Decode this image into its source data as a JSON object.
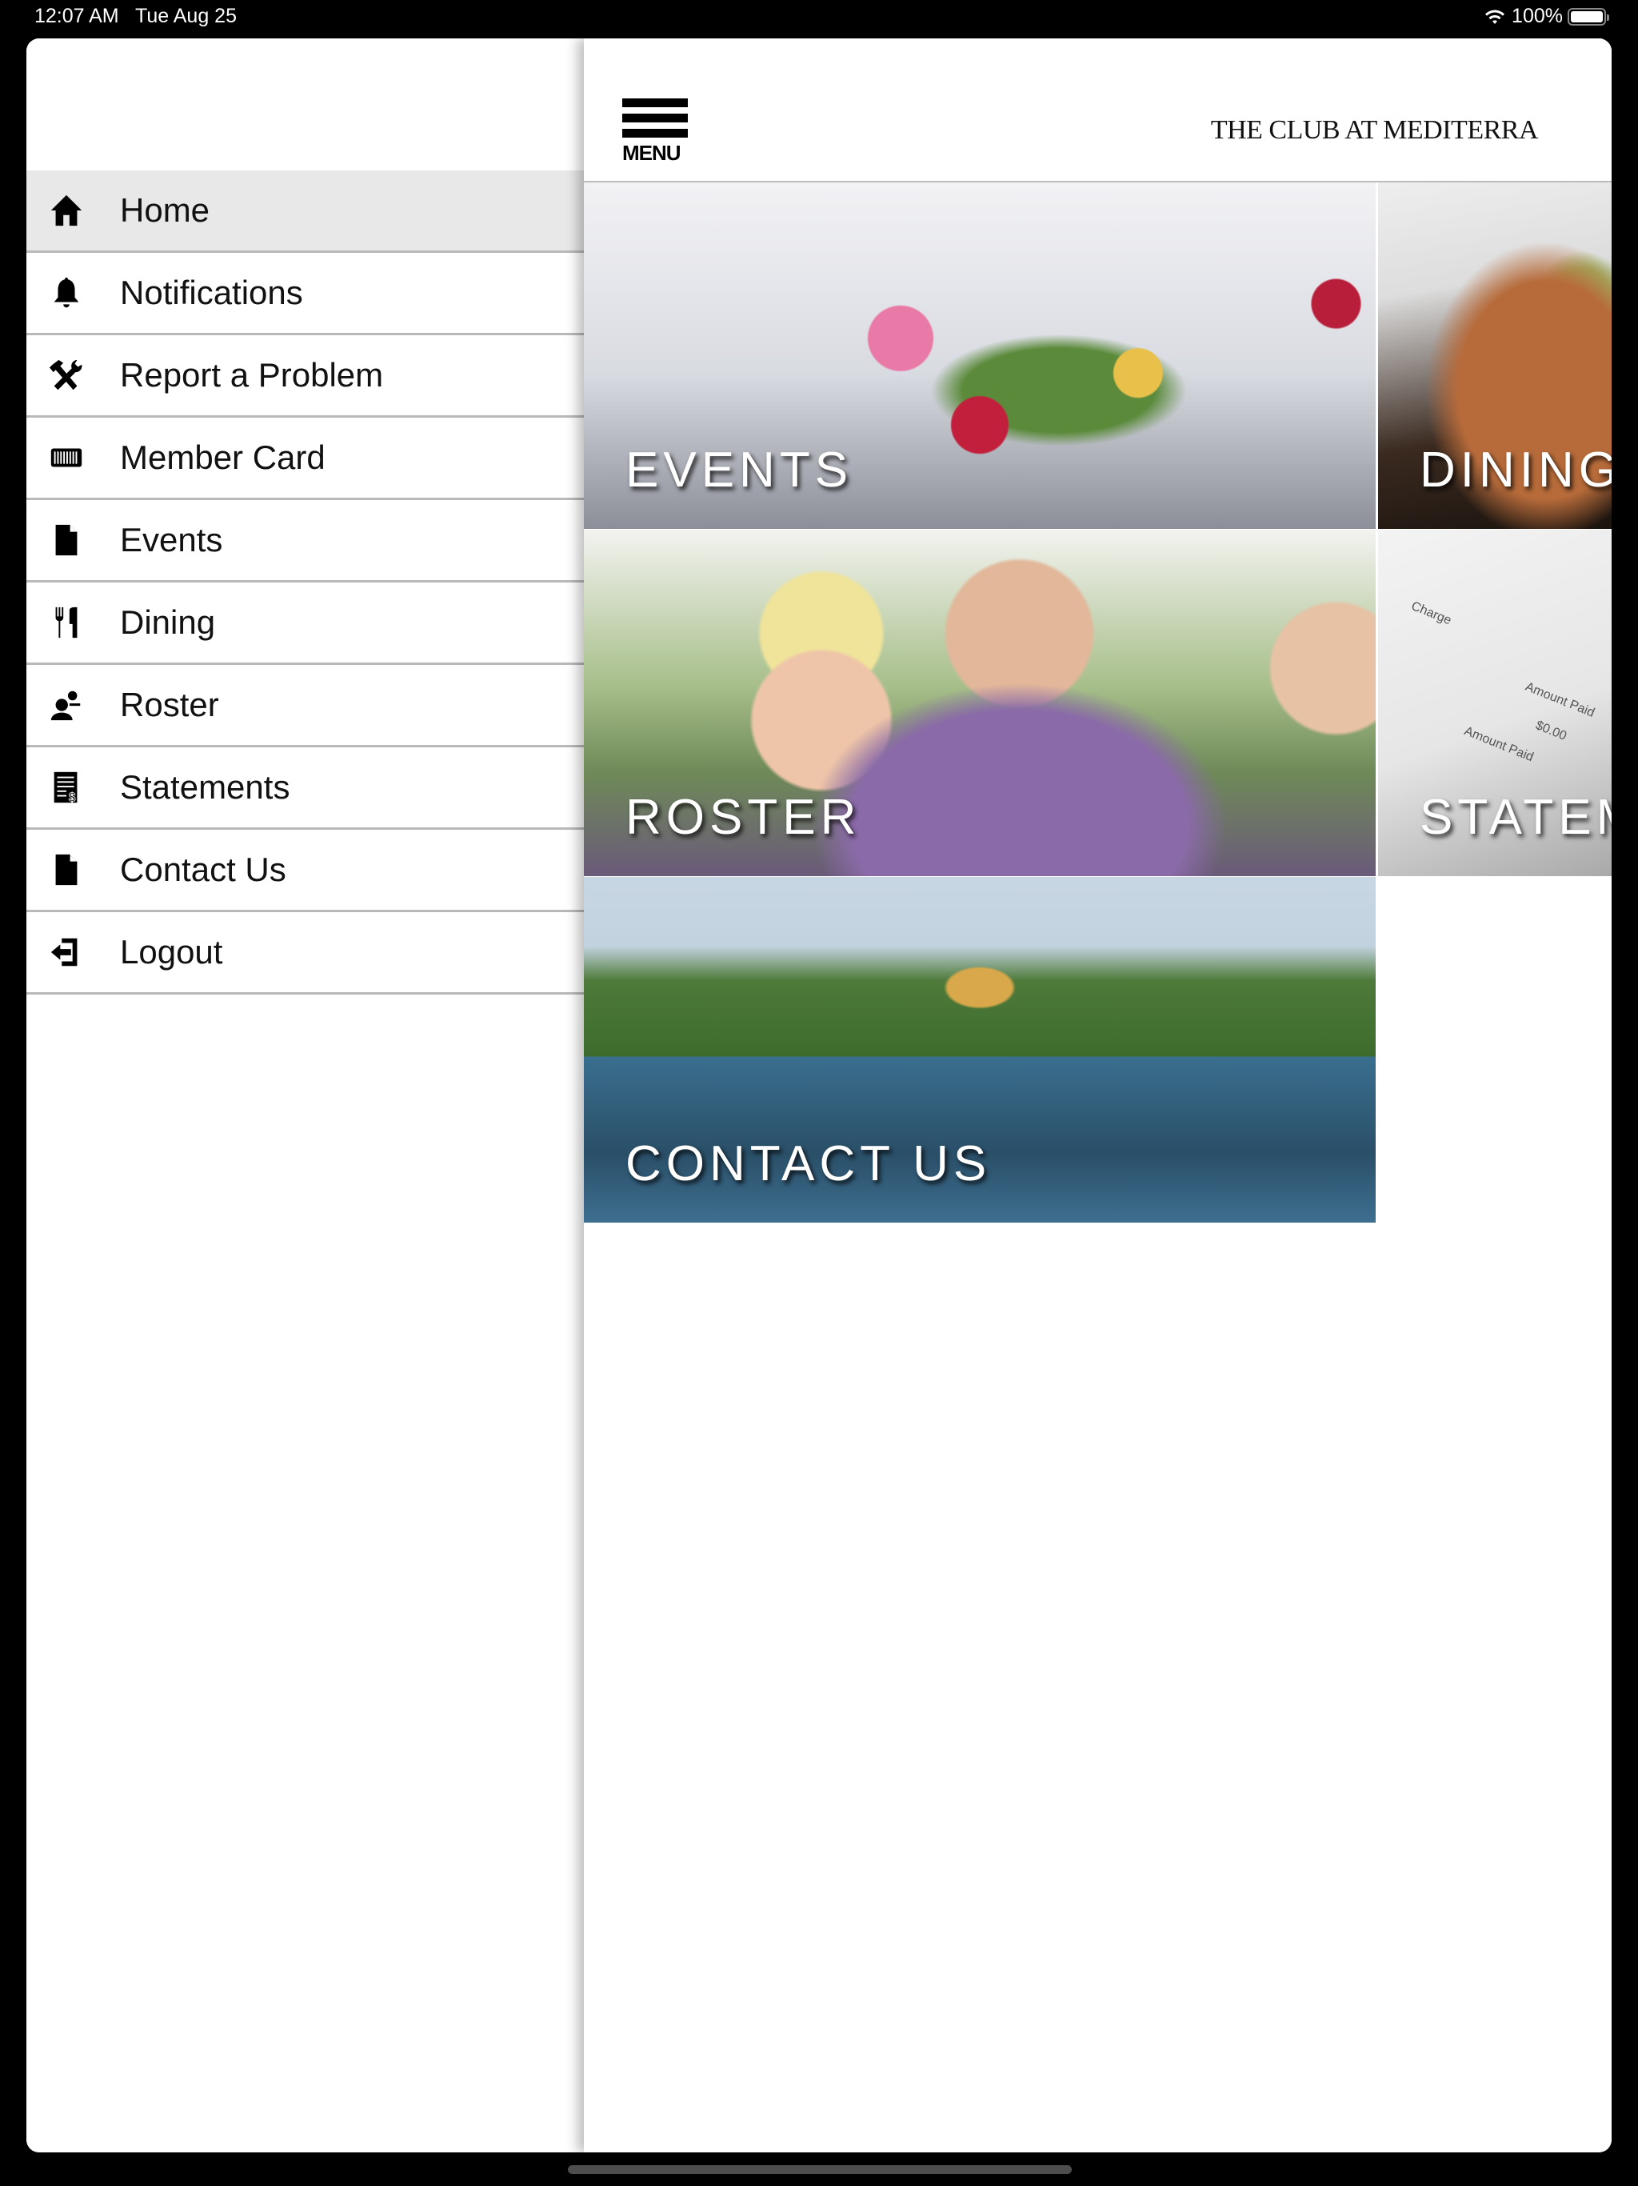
{
  "status_bar": {
    "time": "12:07 AM",
    "date": "Tue Aug 25",
    "battery": "100%",
    "battery_level": 1.0,
    "wifi_icon": "wifi-icon"
  },
  "sidebar": {
    "items": [
      {
        "label": "Home",
        "icon": "home-icon",
        "active": true
      },
      {
        "label": "Notifications",
        "icon": "bell-icon",
        "active": false
      },
      {
        "label": "Report a Problem",
        "icon": "tools-icon",
        "active": false
      },
      {
        "label": "Member Card",
        "icon": "barcode-icon",
        "active": false
      },
      {
        "label": "Events",
        "icon": "document-icon",
        "active": false
      },
      {
        "label": "Dining",
        "icon": "utensils-icon",
        "active": false
      },
      {
        "label": "Roster",
        "icon": "people-icon",
        "active": false
      },
      {
        "label": "Statements",
        "icon": "statement-icon",
        "active": false
      },
      {
        "label": "Contact Us",
        "icon": "document-icon",
        "active": false
      },
      {
        "label": "Logout",
        "icon": "logout-icon",
        "active": false
      }
    ]
  },
  "header": {
    "menu_label": "MENU",
    "brand": "THE CLUB AT MEDITERRA"
  },
  "tiles": [
    {
      "label": "EVENTS"
    },
    {
      "label": "DINING"
    },
    {
      "label": "ROSTER"
    },
    {
      "label": "STATEMENTS"
    },
    {
      "label": "CONTACT US"
    }
  ],
  "statement_doc": {
    "charge": "Charge",
    "amount_paid": "Amount Paid",
    "value": "$0.00"
  }
}
